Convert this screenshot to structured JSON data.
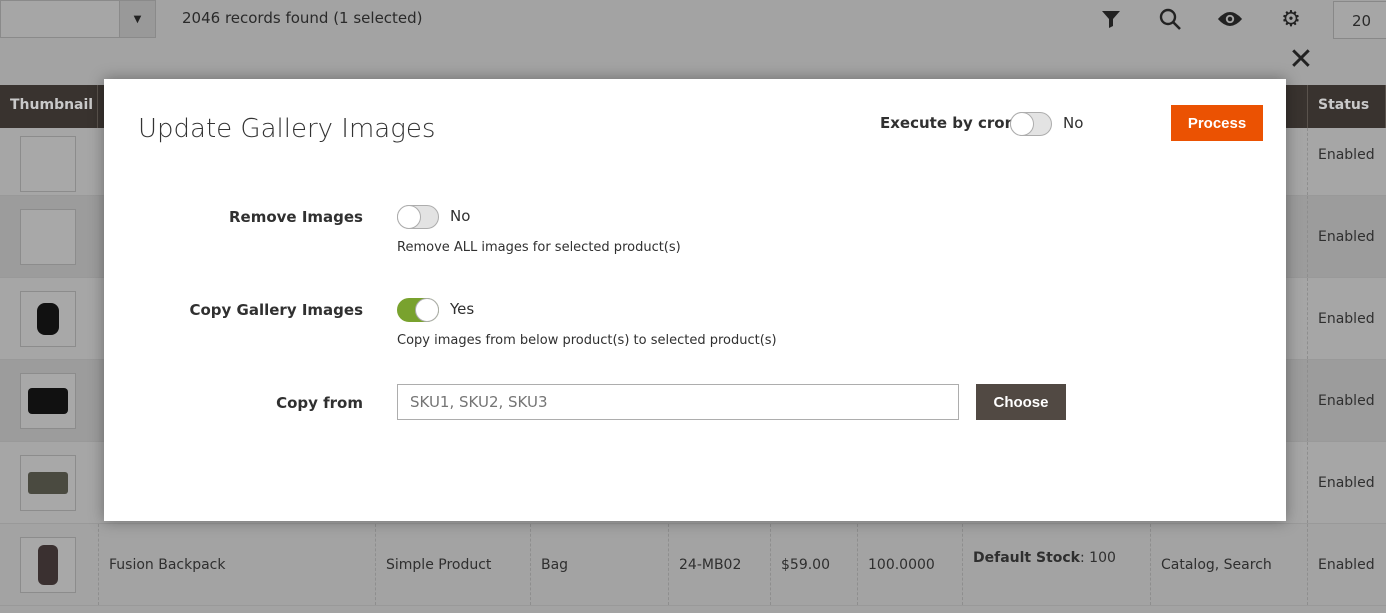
{
  "toolbar": {
    "records": "2046 records found (1 selected)",
    "per_page": "20",
    "icons": [
      "filter-icon",
      "search-icon",
      "eye-icon",
      "gear-icon"
    ]
  },
  "grid": {
    "columns": {
      "thumbnail": "Thumbnail",
      "status": "Status"
    },
    "rows": [
      {
        "status": "Enabled"
      },
      {
        "status": "Enabled"
      },
      {
        "status": "Enabled"
      },
      {
        "status": "Enabled"
      },
      {
        "status": "Enabled"
      },
      {
        "name": "Fusion Backpack",
        "type": "Simple Product",
        "attribute_set": "Bag",
        "sku": "24-MB02",
        "price": "$59.00",
        "quantity": "100.0000",
        "stock_label": "Default Stock",
        "stock_value": ": 100",
        "visibility": "Catalog, Search",
        "status": "Enabled"
      }
    ]
  },
  "modal": {
    "title": "Update Gallery Images",
    "cron_label": "Execute by cron",
    "cron_value": "No",
    "cron_on": false,
    "process": "Process",
    "remove_label": "Remove Images",
    "remove_value": "No",
    "remove_on": false,
    "remove_note": "Remove ALL images for selected product(s)",
    "copy_label": "Copy Gallery Images",
    "copy_value": "Yes",
    "copy_on": true,
    "copy_note": "Copy images from below product(s) to selected product(s)",
    "from_label": "Copy from",
    "from_placeholder": "SKU1, SKU2, SKU3",
    "from_value": "",
    "choose": "Choose",
    "accent": "#eb5202",
    "toggle_on_color": "#79a22e"
  }
}
